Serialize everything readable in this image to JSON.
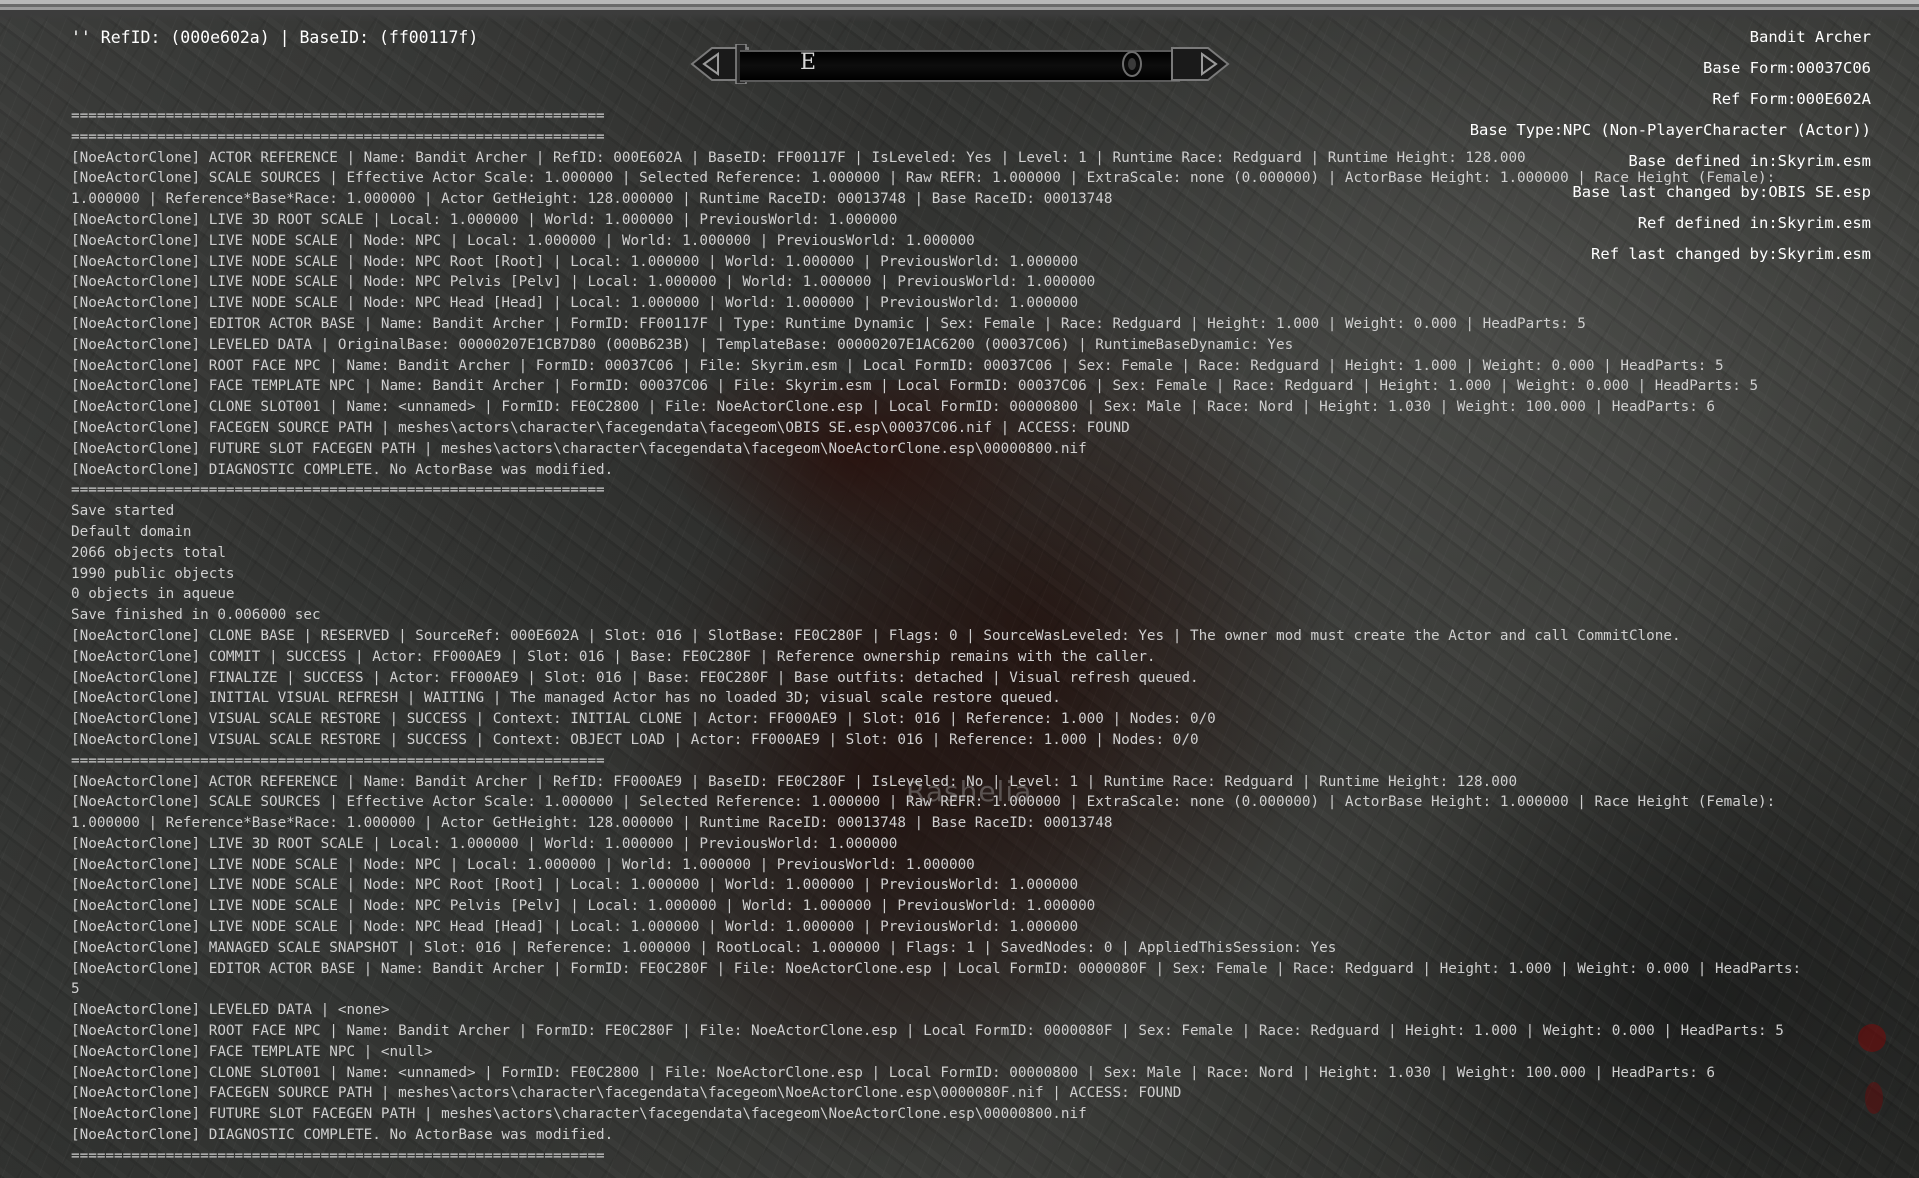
{
  "header": {
    "ref_line": "'' RefID: (000e602a) | BaseID: (ff00117f)"
  },
  "compass": {
    "heading": "E",
    "icons": [
      "compass-left-cap-icon",
      "compass-right-cap-icon",
      "quest-marker-icon"
    ]
  },
  "info_panel": {
    "lines": [
      "Bandit Archer",
      "Base Form:00037C06",
      "Ref Form:000E602A",
      "Base Type:NPC (Non-PlayerCharacter (Actor))",
      "Base defined in:Skyrim.esm",
      "Base last changed by:OBIS SE.esp",
      "Ref defined in:Skyrim.esm",
      "Ref last changed by:Skyrim.esm"
    ]
  },
  "watermark": {
    "name": "Rashelia"
  },
  "console": {
    "lines": [
      "==============================================================",
      "==============================================================",
      "[NoeActorClone] ACTOR REFERENCE | Name: Bandit Archer | RefID: 000E602A | BaseID: FF00117F | IsLeveled: Yes | Level: 1 | Runtime Race: Redguard | Runtime Height: 128.000",
      "[NoeActorClone] SCALE SOURCES | Effective Actor Scale: 1.000000 | Selected Reference: 1.000000 | Raw REFR: 1.000000 | ExtraScale: none (0.000000) | ActorBase Height: 1.000000 | Race Height (Female):",
      "1.000000 | Reference*Base*Race: 1.000000 | Actor GetHeight: 128.000000 | Runtime RaceID: 00013748 | Base RaceID: 00013748",
      "[NoeActorClone] LIVE 3D ROOT SCALE | Local: 1.000000 | World: 1.000000 | PreviousWorld: 1.000000",
      "[NoeActorClone] LIVE NODE SCALE | Node: NPC | Local: 1.000000 | World: 1.000000 | PreviousWorld: 1.000000",
      "[NoeActorClone] LIVE NODE SCALE | Node: NPC Root [Root] | Local: 1.000000 | World: 1.000000 | PreviousWorld: 1.000000",
      "[NoeActorClone] LIVE NODE SCALE | Node: NPC Pelvis [Pelv] | Local: 1.000000 | World: 1.000000 | PreviousWorld: 1.000000",
      "[NoeActorClone] LIVE NODE SCALE | Node: NPC Head [Head] | Local: 1.000000 | World: 1.000000 | PreviousWorld: 1.000000",
      "[NoeActorClone] EDITOR ACTOR BASE | Name: Bandit Archer | FormID: FF00117F | Type: Runtime Dynamic | Sex: Female | Race: Redguard | Height: 1.000 | Weight: 0.000 | HeadParts: 5",
      "[NoeActorClone] LEVELED DATA | OriginalBase: 00000207E1CB7D80 (000B623B) | TemplateBase: 00000207E1AC6200 (00037C06) | RuntimeBaseDynamic: Yes",
      "[NoeActorClone] ROOT FACE NPC | Name: Bandit Archer | FormID: 00037C06 | File: Skyrim.esm | Local FormID: 00037C06 | Sex: Female | Race: Redguard | Height: 1.000 | Weight: 0.000 | HeadParts: 5",
      "[NoeActorClone] FACE TEMPLATE NPC | Name: Bandit Archer | FormID: 00037C06 | File: Skyrim.esm | Local FormID: 00037C06 | Sex: Female | Race: Redguard | Height: 1.000 | Weight: 0.000 | HeadParts: 5",
      "[NoeActorClone] CLONE SLOT001 | Name: <unnamed> | FormID: FE0C2800 | File: NoeActorClone.esp | Local FormID: 00000800 | Sex: Male | Race: Nord | Height: 1.030 | Weight: 100.000 | HeadParts: 6",
      "[NoeActorClone] FACEGEN SOURCE PATH | meshes\\actors\\character\\facegendata\\facegeom\\OBIS SE.esp\\00037C06.nif | ACCESS: FOUND",
      "[NoeActorClone] FUTURE SLOT FACEGEN PATH | meshes\\actors\\character\\facegendata\\facegeom\\NoeActorClone.esp\\00000800.nif",
      "[NoeActorClone] DIAGNOSTIC COMPLETE. No ActorBase was modified.",
      "==============================================================",
      "Save started",
      "Default domain",
      "2066 objects total",
      "1990 public objects",
      "0 objects in aqueue",
      "Save finished in 0.006000 sec",
      "[NoeActorClone] CLONE BASE | RESERVED | SourceRef: 000E602A | Slot: 016 | SlotBase: FE0C280F | Flags: 0 | SourceWasLeveled: Yes | The owner mod must create the Actor and call CommitClone.",
      "[NoeActorClone] COMMIT | SUCCESS | Actor: FF000AE9 | Slot: 016 | Base: FE0C280F | Reference ownership remains with the caller.",
      "[NoeActorClone] FINALIZE | SUCCESS | Actor: FF000AE9 | Slot: 016 | Base: FE0C280F | Base outfits: detached | Visual refresh queued.",
      "[NoeActorClone] INITIAL VISUAL REFRESH | WAITING | The managed Actor has no loaded 3D; visual scale restore queued.",
      "[NoeActorClone] VISUAL SCALE RESTORE | SUCCESS | Context: INITIAL CLONE | Actor: FF000AE9 | Slot: 016 | Reference: 1.000 | Nodes: 0/0",
      "[NoeActorClone] VISUAL SCALE RESTORE | SUCCESS | Context: OBJECT LOAD | Actor: FF000AE9 | Slot: 016 | Reference: 1.000 | Nodes: 0/0",
      "==============================================================",
      "[NoeActorClone] ACTOR REFERENCE | Name: Bandit Archer | RefID: FF000AE9 | BaseID: FE0C280F | IsLeveled: No | Level: 1 | Runtime Race: Redguard | Runtime Height: 128.000",
      "[NoeActorClone] SCALE SOURCES | Effective Actor Scale: 1.000000 | Selected Reference: 1.000000 | Raw REFR: 1.000000 | ExtraScale: none (0.000000) | ActorBase Height: 1.000000 | Race Height (Female):",
      "1.000000 | Reference*Base*Race: 1.000000 | Actor GetHeight: 128.000000 | Runtime RaceID: 00013748 | Base RaceID: 00013748",
      "[NoeActorClone] LIVE 3D ROOT SCALE | Local: 1.000000 | World: 1.000000 | PreviousWorld: 1.000000",
      "[NoeActorClone] LIVE NODE SCALE | Node: NPC | Local: 1.000000 | World: 1.000000 | PreviousWorld: 1.000000",
      "[NoeActorClone] LIVE NODE SCALE | Node: NPC Root [Root] | Local: 1.000000 | World: 1.000000 | PreviousWorld: 1.000000",
      "[NoeActorClone] LIVE NODE SCALE | Node: NPC Pelvis [Pelv] | Local: 1.000000 | World: 1.000000 | PreviousWorld: 1.000000",
      "[NoeActorClone] LIVE NODE SCALE | Node: NPC Head [Head] | Local: 1.000000 | World: 1.000000 | PreviousWorld: 1.000000",
      "[NoeActorClone] MANAGED SCALE SNAPSHOT | Slot: 016 | Reference: 1.000000 | RootLocal: 1.000000 | Flags: 1 | SavedNodes: 0 | AppliedThisSession: Yes",
      "[NoeActorClone] EDITOR ACTOR BASE | Name: Bandit Archer | FormID: FE0C280F | File: NoeActorClone.esp | Local FormID: 0000080F | Sex: Female | Race: Redguard | Height: 1.000 | Weight: 0.000 | HeadParts:",
      "5",
      "[NoeActorClone] LEVELED DATA | <none>",
      "[NoeActorClone] ROOT FACE NPC | Name: Bandit Archer | FormID: FE0C280F | File: NoeActorClone.esp | Local FormID: 0000080F | Sex: Female | Race: Redguard | Height: 1.000 | Weight: 0.000 | HeadParts: 5",
      "[NoeActorClone] FACE TEMPLATE NPC | <null>",
      "[NoeActorClone] CLONE SLOT001 | Name: <unnamed> | FormID: FE0C2800 | File: NoeActorClone.esp | Local FormID: 00000800 | Sex: Male | Race: Nord | Height: 1.030 | Weight: 100.000 | HeadParts: 6",
      "[NoeActorClone] FACEGEN SOURCE PATH | meshes\\actors\\character\\facegendata\\facegeom\\NoeActorClone.esp\\0000080F.nif | ACCESS: FOUND",
      "[NoeActorClone] FUTURE SLOT FACEGEN PATH | meshes\\actors\\character\\facegendata\\facegeom\\NoeActorClone.esp\\00000800.nif",
      "[NoeActorClone] DIAGNOSTIC COMPLETE. No ActorBase was modified.",
      "=============================================================="
    ]
  }
}
